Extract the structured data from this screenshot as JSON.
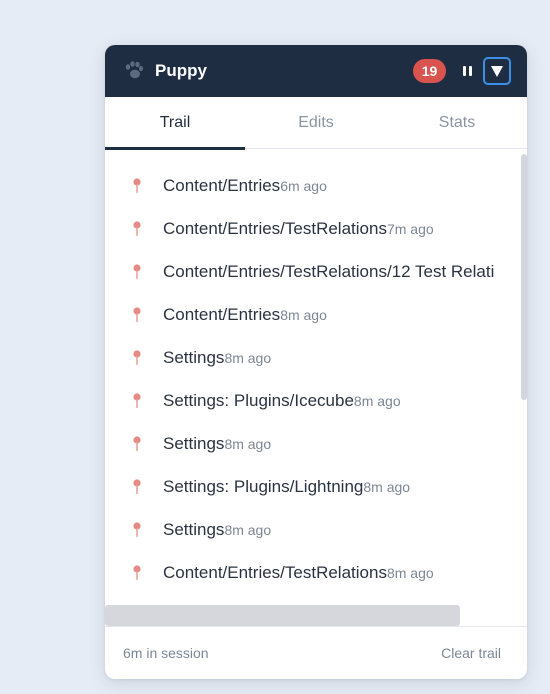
{
  "header": {
    "icon": "paw-icon",
    "title": "Puppy",
    "badge_count": "19",
    "accent": "#1f2d42",
    "badge_color": "#d9534f"
  },
  "tabs": [
    {
      "label": "Trail",
      "active": true
    },
    {
      "label": "Edits",
      "active": false
    },
    {
      "label": "Stats",
      "active": false
    }
  ],
  "trail": [
    {
      "path": "Content/Entries",
      "ago": "6m ago"
    },
    {
      "path": "Content/Entries/TestRelations",
      "ago": "7m ago"
    },
    {
      "path": "Content/Entries/TestRelations/12 Test Relati",
      "ago": ""
    },
    {
      "path": "Content/Entries",
      "ago": "8m ago"
    },
    {
      "path": "Settings",
      "ago": "8m ago"
    },
    {
      "path": "Settings: Plugins/Icecube",
      "ago": "8m ago"
    },
    {
      "path": "Settings",
      "ago": "8m ago"
    },
    {
      "path": "Settings: Plugins/Lightning",
      "ago": "8m ago"
    },
    {
      "path": "Settings",
      "ago": "8m ago"
    },
    {
      "path": "Content/Entries/TestRelations",
      "ago": "8m ago"
    }
  ],
  "footer": {
    "session": "6m in session",
    "clear_label": "Clear trail"
  }
}
